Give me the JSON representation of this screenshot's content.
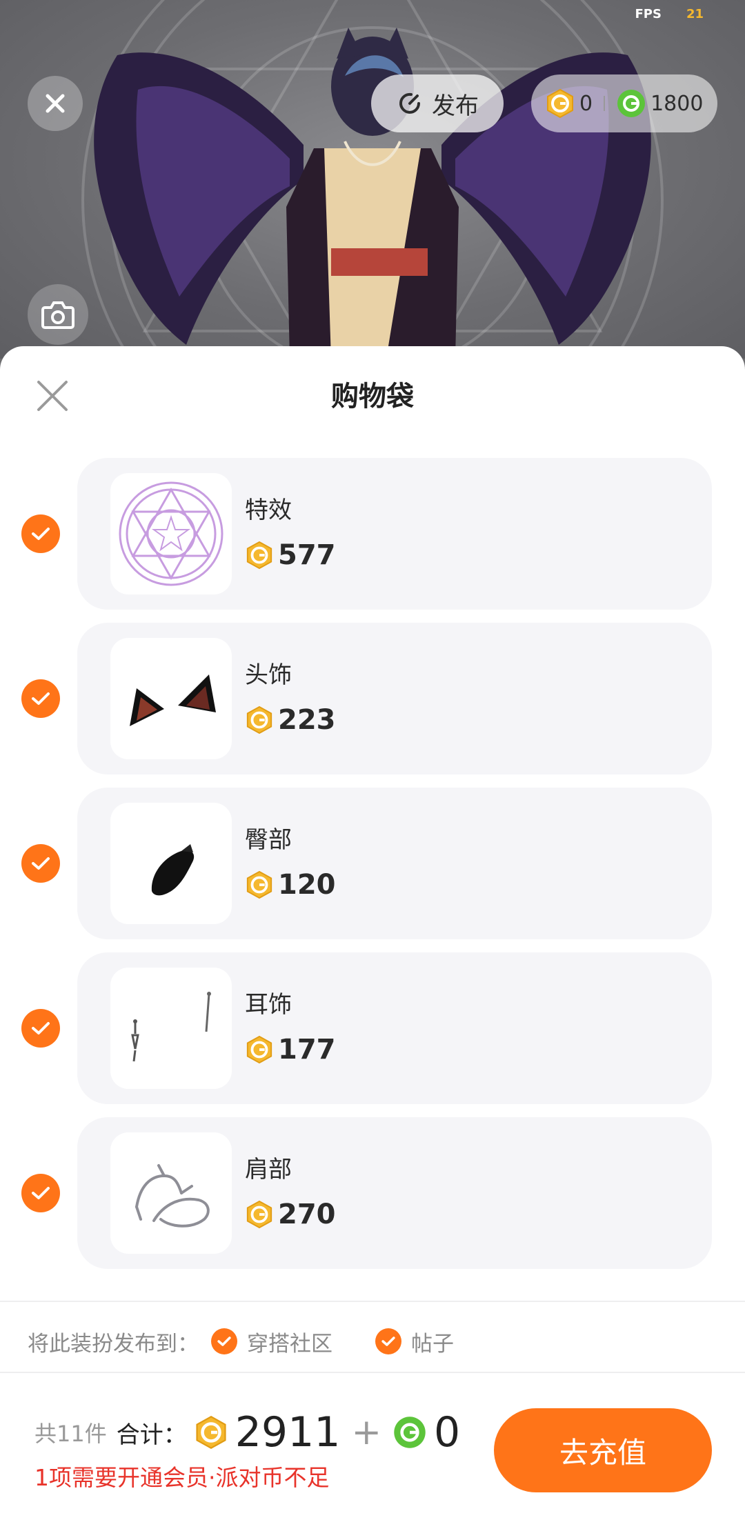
{
  "hud": {
    "fps_label": "FPS",
    "fps_value": "21"
  },
  "top_bar": {
    "publish_label": "发布",
    "balance_gold": "0",
    "balance_green": "1800"
  },
  "sheet": {
    "title": "购物袋",
    "items": [
      {
        "name": "特效",
        "price": "577",
        "checked": true,
        "thumb_icon": "magic-circle-icon"
      },
      {
        "name": "头饰",
        "price": "223",
        "checked": true,
        "thumb_icon": "cat-ears-icon"
      },
      {
        "name": "臀部",
        "price": "120",
        "checked": true,
        "thumb_icon": "tail-icon"
      },
      {
        "name": "耳饰",
        "price": "177",
        "checked": true,
        "thumb_icon": "earring-icon"
      },
      {
        "name": "肩部",
        "price": "270",
        "checked": true,
        "thumb_icon": "shoulder-chain-icon"
      }
    ],
    "publish_to": {
      "label": "将此装扮发布到：",
      "options": [
        "穿搭社区",
        "帖子"
      ]
    },
    "summary": {
      "count": "共11件",
      "total_label": "合计：",
      "total_gold": "2911",
      "plus": "+",
      "total_green": "0",
      "warning": "1项需要开通会员·派对币不足"
    },
    "recharge_label": "去充值"
  },
  "colors": {
    "accent": "#ff7418",
    "warning": "#e8332a",
    "gold_coin": "#f5b82e",
    "green_coin": "#5cc43a",
    "card_bg": "#f5f5f8"
  }
}
